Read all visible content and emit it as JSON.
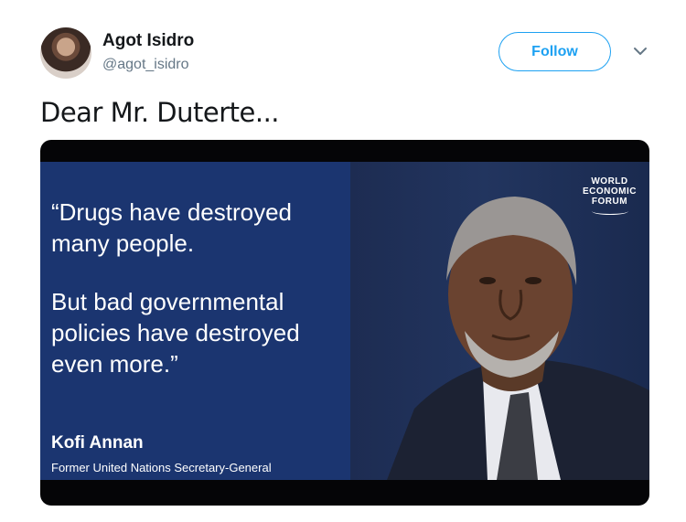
{
  "user": {
    "display_name": "Agot Isidro",
    "handle": "@agot_isidro"
  },
  "actions": {
    "follow_label": "Follow"
  },
  "tweet": {
    "text": "Dear Mr. Duterte..."
  },
  "media": {
    "quote_paragraph_1": "“Drugs have destroyed\nmany people.",
    "quote_paragraph_2": "But bad governmental\npolicies have destroyed\neven more.”",
    "author": "Kofi Annan",
    "author_title": "Former United Nations Secretary-General",
    "logo_line_1": "WORLD",
    "logo_line_2": "ECONOMIC",
    "logo_line_3": "FORUM"
  },
  "colors": {
    "accent": "#1da1f2",
    "quote_panel": "#1b3570",
    "text_primary": "#14171a",
    "text_secondary": "#657786"
  },
  "icons": [
    "avatar-photo",
    "chevron-down-icon",
    "person-photo",
    "world-economic-forum-logo"
  ]
}
